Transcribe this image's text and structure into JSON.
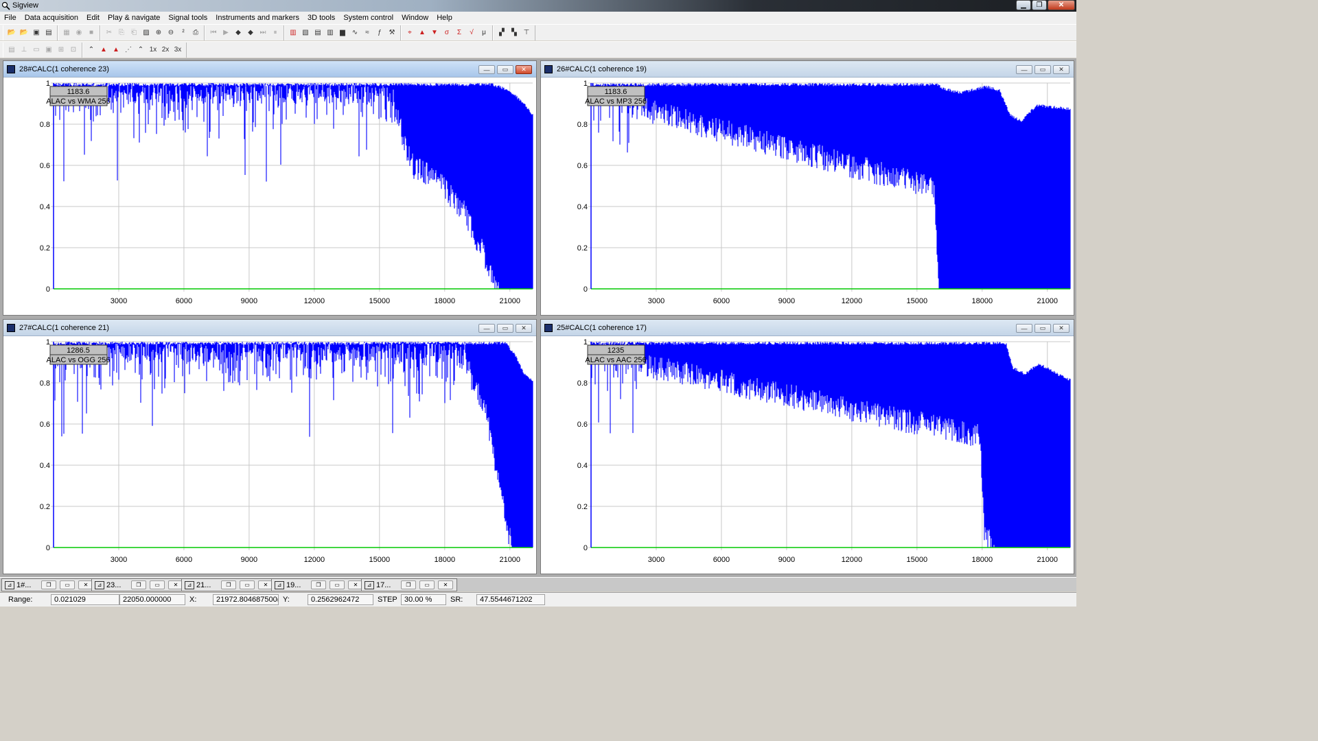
{
  "app": {
    "title": "Sigview",
    "icon": "magnifier-icon",
    "window_controls": [
      "minimize",
      "restore",
      "close"
    ]
  },
  "menu": [
    "File",
    "Data acquisition",
    "Edit",
    "Play & navigate",
    "Signal tools",
    "Instruments and markers",
    "3D tools",
    "System control",
    "Window",
    "Help"
  ],
  "toolbar_row1": [
    [
      "open-icon",
      "open-signal-icon",
      "save-icon",
      "save-as-icon"
    ],
    [
      "record-icon",
      "rec-icon",
      "stop-icon"
    ],
    [
      "cut-icon",
      "copy-icon",
      "paste-icon",
      "image-icon",
      "zoom-in-icon",
      "zoom-out-icon",
      "power-2-icon",
      "print-icon"
    ],
    [
      "first-icon",
      "play-icon",
      "prev-mark-icon",
      "next-mark-icon",
      "last-icon",
      "pause-icon"
    ],
    [
      "spectrum-icon",
      "filter-icon",
      "calculator-icon",
      "bars-icon",
      "histogram-icon",
      "sine-icon",
      "wave-icon",
      "function-icon",
      "tools-icon"
    ],
    [
      "cursor-icon",
      "max-icon",
      "min-icon",
      "stdev-icon",
      "sum-icon",
      "rms-icon",
      "average-icon"
    ],
    [
      "tile-icon",
      "cascade-icon",
      "tree-icon"
    ]
  ],
  "toolbar_row2": [
    [
      "chart-style-icon",
      "chart-line-icon",
      "chart-zoom-icon",
      "chart-fit-icon",
      "grid-icon",
      "grid-select-icon"
    ],
    [
      "line-mode-icon",
      "fill-mode-icon",
      "area-mode-icon",
      "dotted-mode-icon",
      "step-mode-icon",
      "zoom-1x-icon",
      "zoom-2x-icon",
      "zoom-3x-icon"
    ]
  ],
  "toolbar_row2_labels": {
    "zoom1": "1x",
    "zoom2": "2x",
    "zoom3": "3x"
  },
  "colors": {
    "signal": "#0000ff",
    "baseline": "#00c800",
    "grid": "#c8c8c8",
    "label_box": "#c0c0c0"
  },
  "windows": [
    {
      "title": "28#CALC(1 coherence 23)",
      "active": true,
      "marker": {
        "value": "1183.6",
        "label": "ALAC vs WMA 256"
      },
      "chart_data": {
        "type": "area",
        "xlim": [
          0,
          22050
        ],
        "ylim": [
          0,
          1
        ],
        "xticks": [
          3000,
          6000,
          9000,
          12000,
          15000,
          18000,
          21000
        ],
        "yticks": [
          0,
          0.2,
          0.4,
          0.6,
          0.8,
          1
        ],
        "xtick_labels": [
          "3000",
          "6000",
          "9000",
          "12000",
          "15000",
          "18000",
          "21000"
        ],
        "ytick_labels": [
          "0",
          "0.2",
          "0.4",
          "0.6",
          "0.8",
          "1"
        ],
        "series": [
          {
            "x": [
              0,
              15500,
              16500,
              17700,
              18800,
              19700,
              20100,
              20500,
              21000,
              22050
            ],
            "y": [
              1,
              1,
              0.66,
              0.58,
              0.45,
              0.25,
              0.15,
              0.05,
              0,
              0
            ]
          }
        ],
        "upper_envelope": {
          "x": [
            0,
            20200,
            21000,
            21700,
            22050
          ],
          "y": [
            1,
            1,
            0.97,
            0.9,
            0.85
          ]
        },
        "grid": true
      }
    },
    {
      "title": "26#CALC(1 coherence 19)",
      "active": false,
      "marker": {
        "value": "1183.6",
        "label": "ALAC vs MP3 256"
      },
      "chart_data": {
        "type": "area",
        "xlim": [
          0,
          22050
        ],
        "ylim": [
          0,
          1
        ],
        "xticks": [
          3000,
          6000,
          9000,
          12000,
          15000,
          18000,
          21000
        ],
        "yticks": [
          0,
          0.2,
          0.4,
          0.6,
          0.8,
          1
        ],
        "xtick_labels": [
          "3000",
          "6000",
          "9000",
          "12000",
          "15000",
          "18000",
          "21000"
        ],
        "ytick_labels": [
          "0",
          "0.2",
          "0.4",
          "0.6",
          "0.8",
          "1"
        ],
        "series": [
          {
            "x": [
              0,
              15800,
              16050,
              22050
            ],
            "y": [
              1,
              0.55,
              0,
              0
            ]
          }
        ],
        "upper_envelope": {
          "x": [
            0,
            15900,
            16200,
            17000,
            18200,
            18800,
            19300,
            19800,
            20500,
            22050
          ],
          "y": [
            1,
            1,
            0.98,
            0.96,
            0.99,
            0.97,
            0.85,
            0.82,
            0.9,
            0.88
          ]
        },
        "grid": true
      }
    },
    {
      "title": "27#CALC(1 coherence 21)",
      "active": false,
      "marker": {
        "value": "1286.5",
        "label": "ALAC vs OGG 256"
      },
      "chart_data": {
        "type": "area",
        "xlim": [
          0,
          22050
        ],
        "ylim": [
          0,
          1
        ],
        "xticks": [
          3000,
          6000,
          9000,
          12000,
          15000,
          18000,
          21000
        ],
        "yticks": [
          0,
          0.2,
          0.4,
          0.6,
          0.8,
          1
        ],
        "xtick_labels": [
          "3000",
          "6000",
          "9000",
          "12000",
          "15000",
          "18000",
          "21000"
        ],
        "ytick_labels": [
          "0",
          "0.2",
          "0.4",
          "0.6",
          "0.8",
          "1"
        ],
        "series": [
          {
            "x": [
              0,
              18800,
              19300,
              19900,
              20400,
              20800,
              21200,
              22050
            ],
            "y": [
              1,
              1,
              0.86,
              0.72,
              0.4,
              0.2,
              0,
              0
            ]
          }
        ],
        "upper_envelope": {
          "x": [
            0,
            20800,
            21200,
            21600,
            22050
          ],
          "y": [
            1,
            1,
            0.95,
            0.86,
            0.82
          ]
        },
        "grid": true
      }
    },
    {
      "title": "25#CALC(1 coherence 17)",
      "active": false,
      "marker": {
        "value": "1235",
        "label": "ALAC vs AAC 256"
      },
      "chart_data": {
        "type": "area",
        "xlim": [
          0,
          22050
        ],
        "ylim": [
          0,
          1
        ],
        "xticks": [
          3000,
          6000,
          9000,
          12000,
          15000,
          18000,
          21000
        ],
        "yticks": [
          0,
          0.2,
          0.4,
          0.6,
          0.8,
          1
        ],
        "xtick_labels": [
          "3000",
          "6000",
          "9000",
          "12000",
          "15000",
          "18000",
          "21000"
        ],
        "ytick_labels": [
          "0",
          "0.2",
          "0.4",
          "0.6",
          "0.8",
          "1"
        ],
        "series": [
          {
            "x": [
              0,
              17900,
              18100,
              18500,
              19200,
              22050
            ],
            "y": [
              1,
              0.6,
              0.15,
              0.05,
              0,
              0
            ]
          }
        ],
        "upper_envelope": {
          "x": [
            0,
            19100,
            19400,
            20000,
            20600,
            21300,
            22050
          ],
          "y": [
            1,
            1,
            0.88,
            0.85,
            0.9,
            0.86,
            0.82
          ]
        },
        "grid": true
      }
    }
  ],
  "minimized": [
    "1#...",
    "23...",
    "21...",
    "19...",
    "17..."
  ],
  "status": {
    "range_label": "Range:",
    "range_min": "0.021029",
    "range_max": "22050.000000",
    "x_label": "X:",
    "x_value": "21972.804687500(",
    "y_label": "Y:",
    "y_value": "0.2562962472",
    "step_label": "STEP",
    "step_value": "30.00 %",
    "sr_label": "SR:",
    "sr_value": "47.5544671202"
  }
}
